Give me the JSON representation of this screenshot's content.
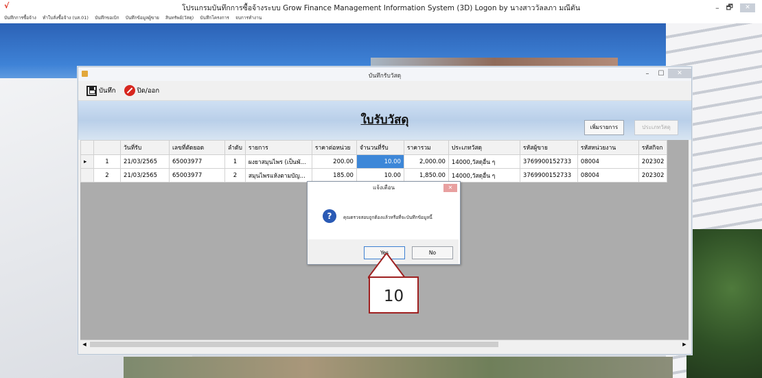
{
  "app": {
    "title": "โปรแกรมบันทึกการซื้อจ้างระบบ  Grow Finance Management Information System (3D) Logon by นางสาววัลลภา  มณีตัน",
    "min": "–",
    "max": "🗗",
    "close": "✕"
  },
  "menu": [
    "บันทึกการซื้อจ้าง",
    "ทำใบสั่งซื้อจ้าง (บส.01)",
    "บันทึกขอเบิก",
    "บันทึกข้อมูลผู้ขาย",
    "สินทรัพย์(วัสดุ)",
    "บันทึกโครงการ",
    "จบการทำงาน"
  ],
  "dialog": {
    "title": "บันทึกรับวัสดุ",
    "min": "–",
    "max": "☐",
    "close": "✕",
    "toolbar": {
      "save_label": "บันทึก",
      "close_label": "ปิด/ออก"
    },
    "form_title": "ใบรับวัสดุ",
    "add_item_label": "เพิ่มรายการ",
    "material_type_label": "ประเภทวัสดุ",
    "columns": [
      "วันที่รับ",
      "เลขที่ตัดยอด",
      "ลำดับ",
      "รายการ",
      "ราคาต่อหน่วย",
      "จำนวนที่รับ",
      "ราคารวม",
      "ประเภทวัสดุ",
      "รหัสผู้ขาย",
      "รหัสหน่วยงาน",
      "รหัสกิจก"
    ],
    "rows": [
      {
        "marker": "▸",
        "no": "1",
        "date": "21/03/2565",
        "ref": "65003977",
        "seq": "1",
        "item": "ผงยาสมุนไพร (เป็นพั...",
        "unit_price": "200.00",
        "qty": "10.00",
        "total": "2,000.00",
        "type": "14000,วัสดุอื่น ๆ",
        "vendor": "3769900152733",
        "dept": "08004",
        "activity": "202302"
      },
      {
        "marker": "",
        "no": "2",
        "date": "21/03/2565",
        "ref": "65003977",
        "seq": "2",
        "item": "สมุนไพรแห้งตามบัญ...",
        "unit_price": "185.00",
        "qty": "10.00",
        "total": "1,850.00",
        "type": "14000,วัสดุอื่น ๆ",
        "vendor": "3769900152733",
        "dept": "08004",
        "activity": "202302"
      }
    ]
  },
  "message_box": {
    "title": "แจ้งเตือน",
    "close": "✕",
    "icon": "question-icon",
    "icon_glyph": "?",
    "text": "คุณตรวจสอบถูกต้องแล้วหรือที่จะบันทึกข้อมูลนี้",
    "yes_label": "Yes",
    "no_label": "No"
  },
  "callout": {
    "number": "10"
  },
  "colors": {
    "selected_cell": "#3d87d8",
    "callout_border": "#9e2020",
    "close_icon": "#d7261e"
  }
}
